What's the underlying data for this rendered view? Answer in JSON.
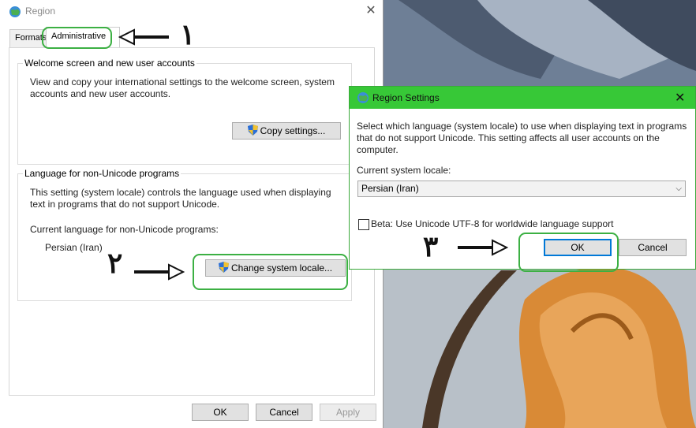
{
  "region_window": {
    "title": "Region",
    "tabs": [
      "Formats",
      "Administrative"
    ],
    "welcome_group": {
      "title": "Welcome screen and new user accounts",
      "description": "View and copy your international settings to the welcome screen, system accounts and new user accounts.",
      "copy_button": "Copy settings..."
    },
    "nonunicode_group": {
      "title": "Language for non-Unicode programs",
      "description": "This setting (system locale) controls the language used when displaying text in programs that do not support Unicode.",
      "current_label": "Current language for non-Unicode programs:",
      "current_value": "Persian (Iran)",
      "change_button": "Change system locale..."
    },
    "footer": {
      "ok": "OK",
      "cancel": "Cancel",
      "apply": "Apply"
    }
  },
  "region_settings_dialog": {
    "title": "Region Settings",
    "description": "Select which language (system locale) to use when displaying text in programs that do not support Unicode. This setting affects all user accounts on the computer.",
    "current_locale_label": "Current system locale:",
    "current_locale_value": "Persian (Iran)",
    "beta_checkbox_label": "Beta: Use Unicode UTF-8 for worldwide language support",
    "beta_checked": false,
    "ok": "OK",
    "cancel": "Cancel"
  },
  "annotations": {
    "step1": "۱",
    "step2": "۲",
    "step3": "۳",
    "highlight_color": "#3cb043"
  },
  "colors": {
    "dialog_titlebar": "#37c837",
    "primary_button_border": "#0078d7"
  }
}
